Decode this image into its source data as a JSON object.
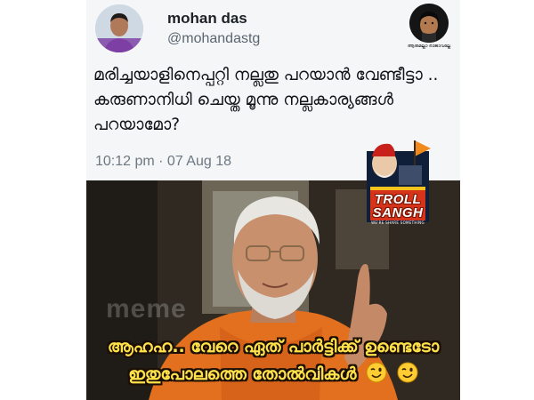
{
  "tweet": {
    "display_name": "mohan das",
    "handle": "@mohandastg",
    "text": "മരിച്ചയാളിനെപ്പറ്റി നല്ലതു പറയാൻ വേണ്ടീട്ടാ .. കരുണാനിധി ചെയ്ത മൂന്നു നല്ലകാര്യങ്ങൾ പറയാമോ?",
    "timestamp": "10:12 pm · 07 Aug 18"
  },
  "corner_logo": {
    "icon": "page-logo-icon",
    "caption": "ആരുമല്ലാ രാജാവല്ലേ"
  },
  "meme": {
    "watermark": "meme",
    "caption_line1": "ആഹഹ.. വേറെ ഏത് പാർട്ടിക്ക് ഉണ്ടെടോ",
    "caption_line2": "ഇതുപോലത്തെ തോൽവികൾ",
    "emoji": "winking-face-icon"
  },
  "troll_logo": {
    "line1": "TROLL",
    "line2": "SANGH",
    "tagline": "WE'RE SHARE SOMETHING"
  },
  "colors": {
    "caption_text": "#ffe14a",
    "caption_outline": "#1a0e05",
    "tweet_background": "#f4f6f8",
    "saffron": "#e2701e"
  }
}
